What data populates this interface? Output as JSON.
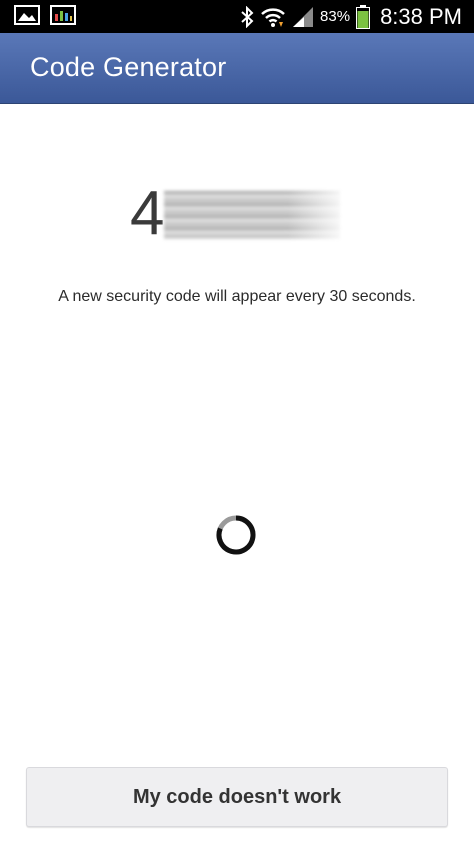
{
  "status_bar": {
    "battery_percent": "83%",
    "time": "8:38 PM",
    "left_icons": [
      "gallery-icon",
      "monitor-icon"
    ],
    "right_icons": [
      "bluetooth-icon",
      "wifi-icon",
      "signal-icon",
      "battery-icon"
    ],
    "battery_color": "#7cc242",
    "battery_level": 0.83
  },
  "app_bar": {
    "title": "Code Generator",
    "color": "#3b5998"
  },
  "code": {
    "visible_digit": "4"
  },
  "info_text": "A new security code will appear every 30 seconds.",
  "button": {
    "label": "My code doesn't work"
  }
}
